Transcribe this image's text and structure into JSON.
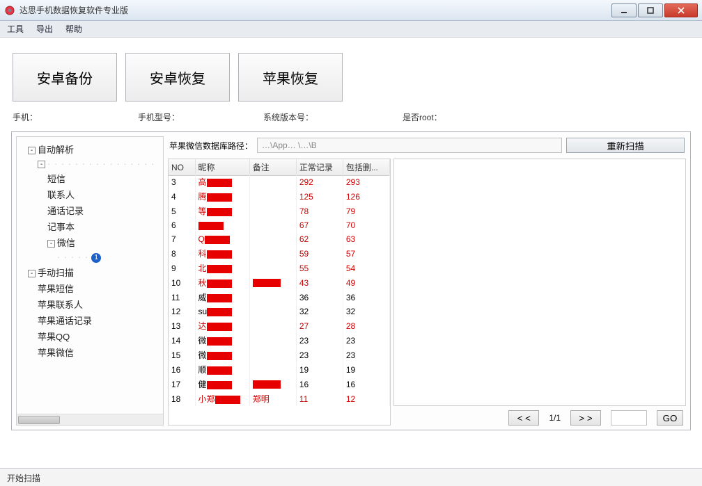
{
  "window": {
    "title": "达思手机数据恢复软件专业版"
  },
  "menu": {
    "tools": "工具",
    "export": "导出",
    "help": "帮助"
  },
  "main_buttons": {
    "android_backup": "安卓备份",
    "android_restore": "安卓恢复",
    "apple_restore": "苹果恢复"
  },
  "info": {
    "phone": "手机：",
    "model": "手机型号：",
    "sysver": "系统版本号：",
    "root": "是否root："
  },
  "path": {
    "label": "苹果微信数据库路径：",
    "value": "…\\App… \\…\\B",
    "rescan": "重新扫描"
  },
  "tree": {
    "auto": "自动解析",
    "sms": "短信",
    "contacts": "联系人",
    "calllog": "通话记录",
    "notes": "记事本",
    "wechat": "微信",
    "wechat_sub": "· · · · ·",
    "badge": "1",
    "manual": "手动扫描",
    "apple_sms": "苹果短信",
    "apple_contacts": "苹果联系人",
    "apple_calllog": "苹果通话记录",
    "apple_qq": "苹果QQ",
    "apple_wechat": "苹果微信"
  },
  "table": {
    "headers": {
      "no": "NO",
      "nick": "昵称",
      "note": "备注",
      "normal": "正常记录",
      "deleted": "包括删..."
    },
    "rows": [
      {
        "no": "3",
        "nick": "高",
        "note": "",
        "a": "292",
        "b": "293",
        "red": true
      },
      {
        "no": "4",
        "nick": "腾",
        "note": "",
        "a": "125",
        "b": "126",
        "red": true
      },
      {
        "no": "5",
        "nick": "等",
        "note": "",
        "a": "78",
        "b": "79",
        "red": true
      },
      {
        "no": "6",
        "nick": "",
        "note": "",
        "a": "67",
        "b": "70",
        "red": true
      },
      {
        "no": "7",
        "nick": "Q",
        "note": "",
        "a": "62",
        "b": "63",
        "red": true
      },
      {
        "no": "8",
        "nick": "科",
        "note": "",
        "a": "59",
        "b": "57",
        "red": true
      },
      {
        "no": "9",
        "nick": "北",
        "note": "",
        "a": "55",
        "b": "54",
        "red": true
      },
      {
        "no": "10",
        "nick": "秋",
        "note": "█",
        "a": "43",
        "b": "49",
        "red": true
      },
      {
        "no": "11",
        "nick": "威",
        "note": "",
        "a": "36",
        "b": "36",
        "red": false
      },
      {
        "no": "12",
        "nick": "su",
        "note": "",
        "a": "32",
        "b": "32",
        "red": false
      },
      {
        "no": "13",
        "nick": "达",
        "note": "",
        "a": "27",
        "b": "28",
        "red": true
      },
      {
        "no": "14",
        "nick": "微",
        "note": "",
        "a": "23",
        "b": "23",
        "red": false
      },
      {
        "no": "15",
        "nick": "微",
        "note": "",
        "a": "23",
        "b": "23",
        "red": false
      },
      {
        "no": "16",
        "nick": "顺",
        "note": "",
        "a": "19",
        "b": "19",
        "red": false
      },
      {
        "no": "17",
        "nick": "健",
        "note": "█",
        "a": "16",
        "b": "16",
        "red": false
      },
      {
        "no": "18",
        "nick": "小郑",
        "note": "郑明",
        "a": "11",
        "b": "12",
        "red": true
      }
    ]
  },
  "pager": {
    "prev": "< <",
    "page": "1/1",
    "next": "> >",
    "go": "GO"
  },
  "status": "开始扫描"
}
